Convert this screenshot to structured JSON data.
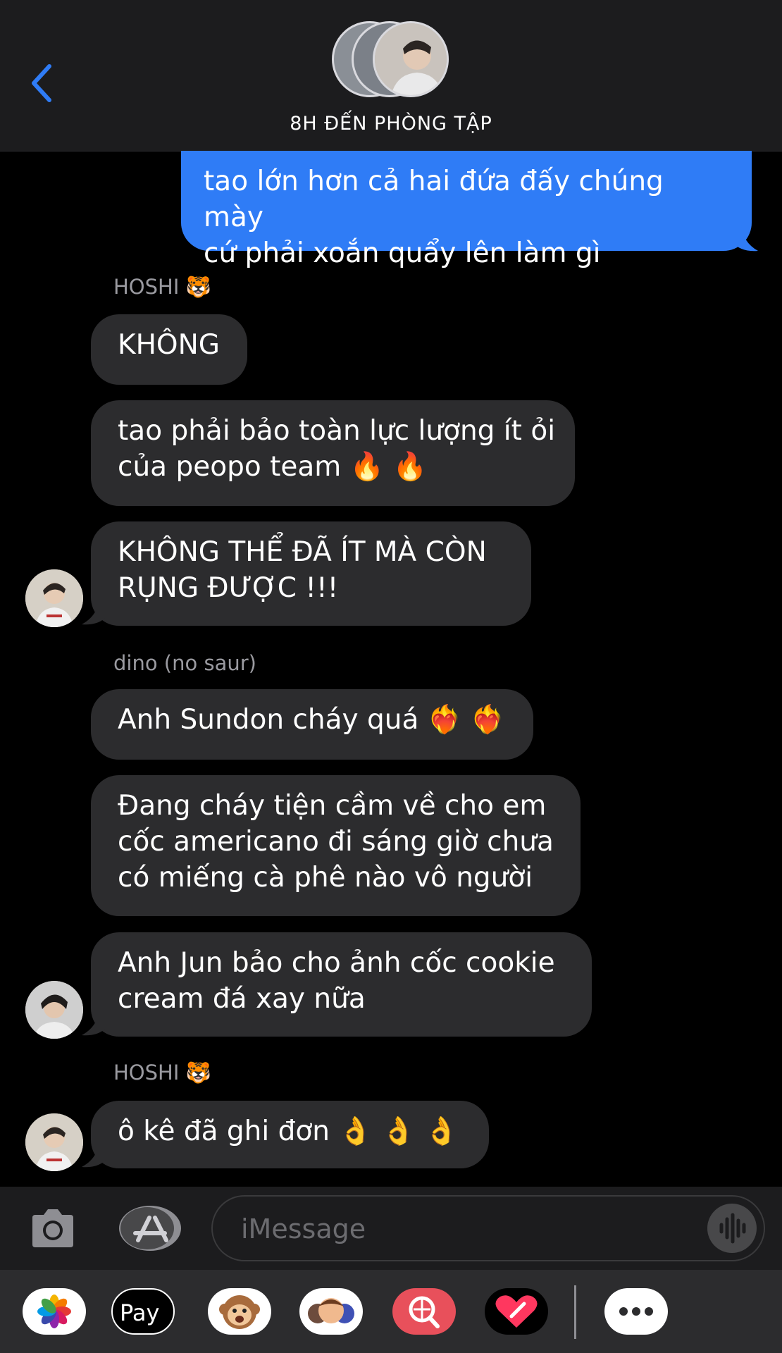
{
  "header": {
    "title": "8H ĐẾN PHÒNG TẬP",
    "back_icon": "chevron-left-icon",
    "accent": "#2f7cf6"
  },
  "messages": {
    "sent_1": {
      "line1": "tao lớn hơn cả hai đứa đấy chúng mày",
      "line2": "cứ phải xoắn quẩy lên làm gì"
    },
    "sender_hoshi_1": "HOSHI 🐯",
    "hoshi_1": "KHÔNG",
    "hoshi_2": {
      "line1": "tao phải bảo toàn lực lượng ít ỏi",
      "line2": "của peopo team 🔥 🔥"
    },
    "hoshi_3": {
      "line1": "KHÔNG THỂ ĐÃ ÍT MÀ CÒN",
      "line2": "RỤNG ĐƯỢC !!!"
    },
    "sender_dino": "dino (no saur)",
    "dino_1": "Anh Sundon cháy quá ❤️‍🔥 ❤️‍🔥",
    "dino_2": {
      "line1": "Đang cháy tiện cầm về cho em",
      "line2": "cốc americano đi sáng giờ chưa",
      "line3": "có miếng cà phê nào vô người"
    },
    "dino_3": {
      "line1": "Anh Jun bảo cho ảnh cốc cookie",
      "line2": "cream đá xay nữa"
    },
    "sender_hoshi_2": "HOSHI 🐯",
    "hoshi_4": "ô kê đã ghi đơn 👌 👌 👌"
  },
  "composer": {
    "placeholder": "iMessage"
  },
  "tray": {
    "apple_pay_label": " Pay"
  },
  "colors": {
    "sent_bubble": "#2f7cf6",
    "received_bubble": "#2c2c2e",
    "background": "#000000"
  }
}
